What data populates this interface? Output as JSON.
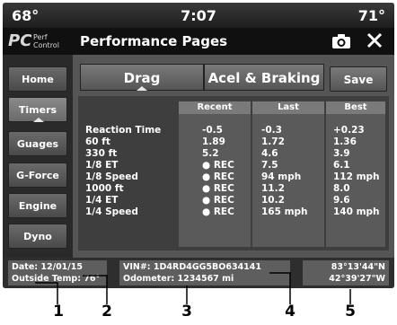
{
  "status_bar": {
    "temp_left": "68°",
    "time": "7:07",
    "temp_right": "71°"
  },
  "title_bar": {
    "logo_letters": "PC",
    "logo_perf": "Perf",
    "logo_control": "Control",
    "title": "Performance Pages",
    "camera_icon": "camera-icon",
    "close_icon": "close-icon"
  },
  "sidebar": {
    "items": [
      {
        "label": "Home"
      },
      {
        "label": "Timers",
        "active": true
      },
      {
        "label": "Guages"
      },
      {
        "label": "G-Force"
      },
      {
        "label": "Engine"
      },
      {
        "label": "Dyno"
      }
    ]
  },
  "tabs": [
    {
      "label": "Drag",
      "active": true
    },
    {
      "label": "Acel & Braking"
    }
  ],
  "save_label": "Save",
  "table": {
    "columns": [
      "Recent",
      "Last",
      "Best"
    ],
    "rows": [
      {
        "label": "Reaction Time",
        "recent": "-0.5",
        "last": "-0.3",
        "best": "+0.23"
      },
      {
        "label": "60 ft",
        "recent": "1.89",
        "last": "1.72",
        "best": "1.36"
      },
      {
        "label": "330 ft",
        "recent": "5.2",
        "last": "4.6",
        "best": "3.9"
      },
      {
        "label": "1/8 ET",
        "recent": "● REC",
        "last": "7.5",
        "best": "6.1"
      },
      {
        "label": "1/8 Speed",
        "recent": "● REC",
        "last": "94 mph",
        "best": "112 mph"
      },
      {
        "label": "1000 ft",
        "recent": "● REC",
        "last": "11.2",
        "best": "8.0"
      },
      {
        "label": "1/4 ET",
        "recent": "● REC",
        "last": "10.2",
        "best": "9.6"
      },
      {
        "label": "1/4 Speed",
        "recent": "● REC",
        "last": "165 mph",
        "best": "140 mph"
      }
    ]
  },
  "info": {
    "date": "Date: 12/01/15",
    "outside_temp": "Outside Temp: 76°",
    "vin": "VIN#: 1D4RD4GG5BO634141",
    "odometer": "Odometer: 1234567 mi",
    "lat": "83°13'44\"N",
    "lon": "42°39'27\"W"
  },
  "callouts": [
    "1",
    "2",
    "3",
    "4",
    "5"
  ]
}
